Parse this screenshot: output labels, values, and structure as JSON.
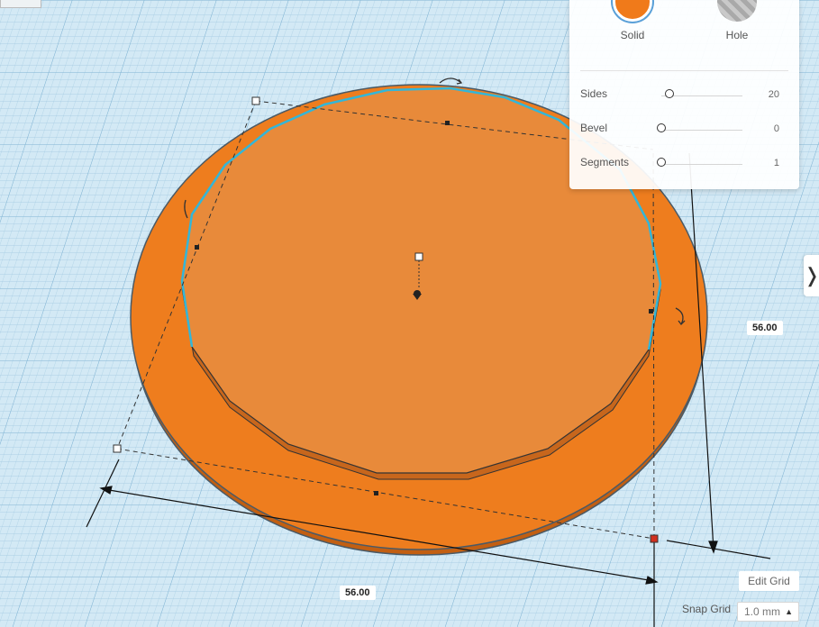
{
  "inspector": {
    "solid_label": "Solid",
    "hole_label": "Hole",
    "properties": [
      {
        "name": "Sides",
        "value": "20",
        "level": 0.1
      },
      {
        "name": "Bevel",
        "value": "0",
        "level": 0
      },
      {
        "name": "Segments",
        "value": "1",
        "level": 0
      }
    ]
  },
  "dimensions": {
    "width_label": "56.00",
    "depth_label": "56.00"
  },
  "grid": {
    "edit_label": "Edit Grid",
    "snap_label": "Snap Grid",
    "snap_value": "1.0 mm"
  },
  "colors": {
    "shape": "#f07a1a",
    "selection_outline": "#33b6d8",
    "grid_background": "#cfe6f3"
  },
  "icons": {
    "panel_toggle": "chevron-right-icon"
  }
}
